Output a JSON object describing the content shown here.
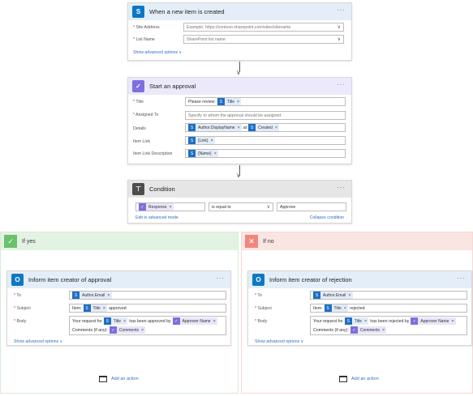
{
  "trigger": {
    "title": "When a new item is created",
    "menu": "···",
    "site_label": "* Site Address",
    "site_placeholder": "Example: https://contoso.sharepoint.com/sites/sitename",
    "list_label": "* List Name",
    "list_placeholder": "SharePoint list name",
    "advanced": "Show advanced options ∨",
    "accent": "#0f78c4"
  },
  "approval": {
    "title": "Start an approval",
    "menu": "···",
    "title_label": "* Title",
    "title_prefix": "Please review:",
    "title_token": "Title",
    "assigned_label": "* Assigned To",
    "assigned_placeholder": "Specify to whom the approval should be assigned.",
    "details_label": "Details",
    "details_token1": "Author.DisplayName",
    "details_at": "at",
    "details_token2": "Created",
    "link_label": "Item Link",
    "link_token": "{Link}",
    "linkdesc_label": "Item Link Description",
    "linkdesc_token": "{Name}",
    "accent": "#7e6fde"
  },
  "condition": {
    "title": "Condition",
    "menu": "···",
    "left_token": "Response",
    "operator": "is equal to",
    "right_value": "Approve",
    "edit_link": "Edit in advanced mode",
    "collapse_link": "Collapse condition",
    "accent": "#4d4d4d"
  },
  "if_yes": {
    "label": "If yes",
    "color": "#6cc16c",
    "action": {
      "title": "Inform item creator of approval",
      "menu": "···",
      "to_label": "* To",
      "to_token": "Author.Email",
      "subject_label": "* Subject",
      "subject_prefix": "Item:",
      "subject_token": "Title",
      "subject_suffix": "approved",
      "body_label": "* Body",
      "body_prefix": "Your request for",
      "body_token1": "Title",
      "body_text": "has been approved by",
      "body_token2": "Approver Name",
      "body_text2": "Comments (if any):",
      "body_token3": "Comments",
      "advanced": "Show advanced options ∨"
    },
    "add_action": "Add an action"
  },
  "if_no": {
    "label": "If no",
    "color": "#f0877e",
    "action": {
      "title": "Inform item creator of rejection",
      "menu": "···",
      "to_label": "* To",
      "to_token": "Author.Email",
      "subject_label": "* Subject",
      "subject_prefix": "Item:",
      "subject_token": "Title",
      "subject_suffix": "rejected",
      "body_label": "* Body",
      "body_prefix": "Your request for",
      "body_token1": "Title",
      "body_text": "has been rejected by",
      "body_token2": "Approver Name",
      "body_text2": "Comments (if any):",
      "body_token3": "Comments",
      "advanced": "Show advanced options ∨"
    },
    "add_action": "Add an action"
  }
}
